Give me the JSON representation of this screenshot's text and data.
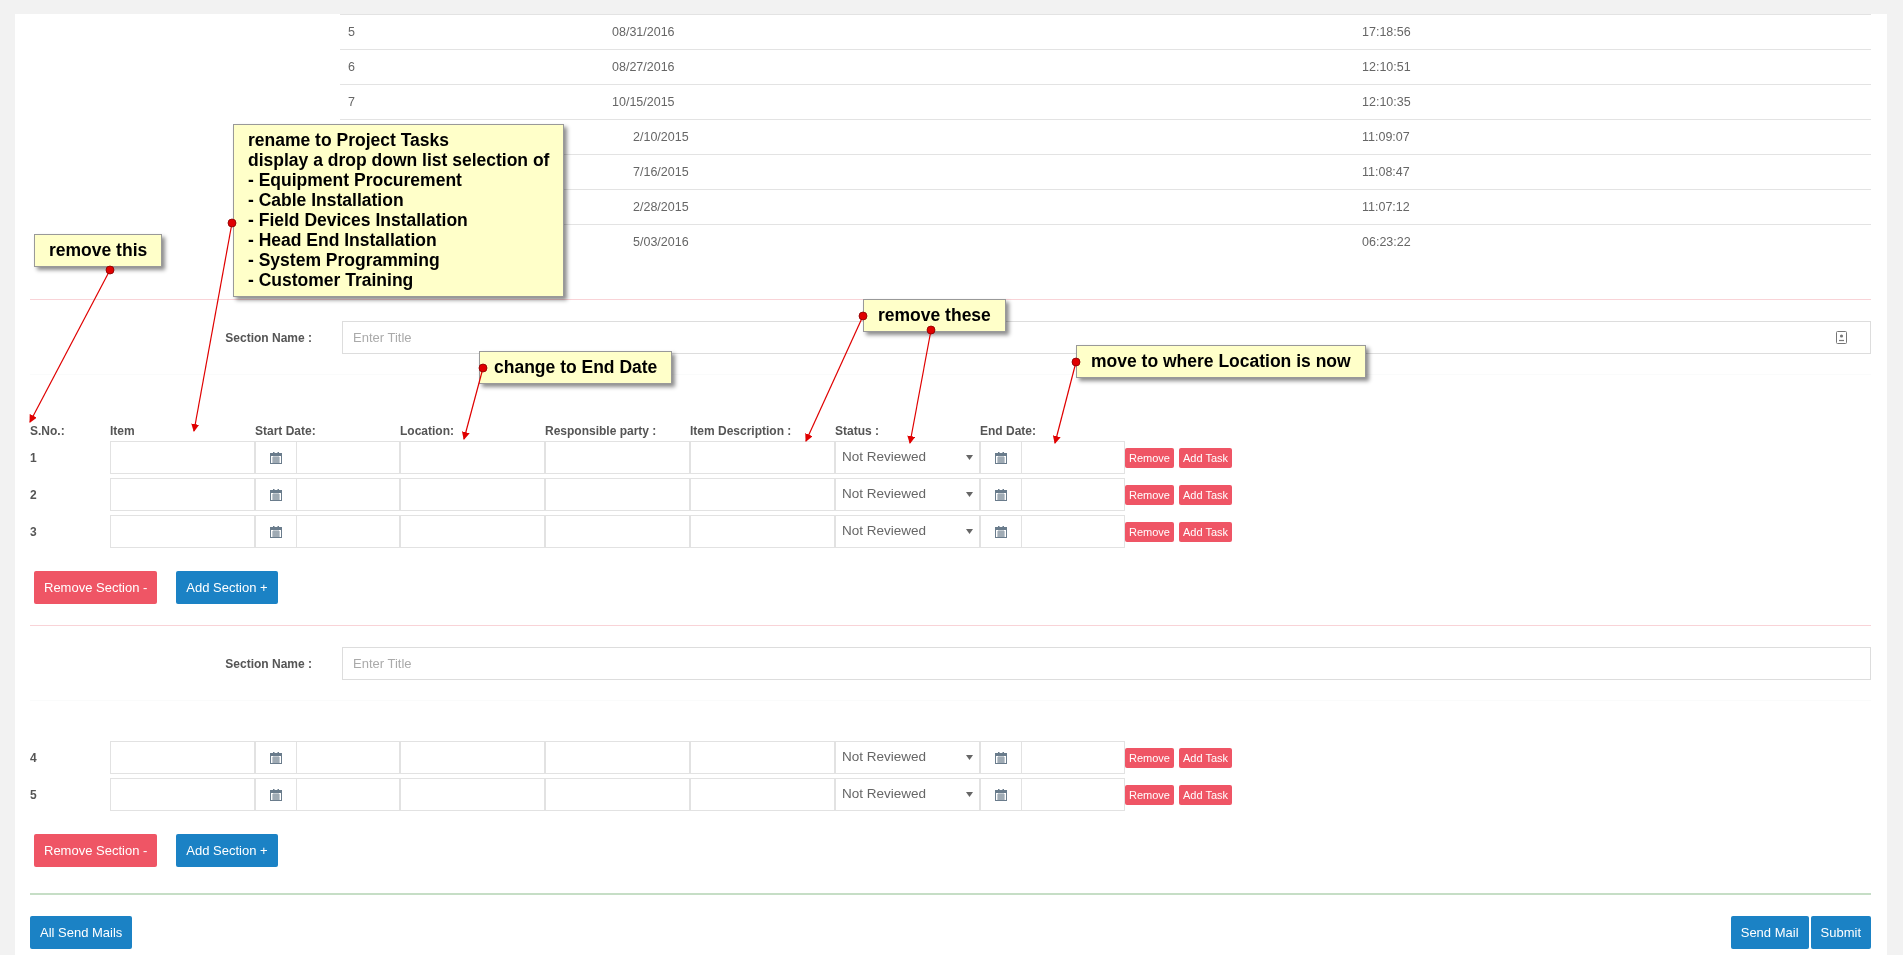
{
  "history_table": {
    "rows": [
      {
        "number": "5",
        "date": "08/31/2016",
        "time": "17:18:56"
      },
      {
        "number": "6",
        "date": "08/27/2016",
        "time": "12:10:51"
      },
      {
        "number": "7",
        "date": "10/15/2015",
        "time": "12:10:35"
      },
      {
        "date": "2/10/2015",
        "time": "11:09:07"
      },
      {
        "date": "7/16/2015",
        "time": "11:08:47"
      },
      {
        "date": "2/28/2015",
        "time": "11:07:12"
      },
      {
        "date": "5/03/2016",
        "time": "06:23:22"
      }
    ]
  },
  "sections": [
    {
      "label": "Section Name :",
      "placeholder": "Enter Title",
      "card_icon": true,
      "columns": [
        "S.No.:",
        "Item",
        "Start Date:",
        "Location:",
        "Responsible party :",
        "Item Description :",
        "Status :",
        "End Date:"
      ],
      "rows": [
        {
          "sno": "1",
          "status": "Not Reviewed",
          "remove": "Remove",
          "add_task": "Add Task"
        },
        {
          "sno": "2",
          "status": "Not Reviewed",
          "remove": "Remove",
          "add_task": "Add Task"
        },
        {
          "sno": "3",
          "status": "Not Reviewed",
          "remove": "Remove",
          "add_task": "Add Task"
        }
      ],
      "remove_section": "Remove Section -",
      "add_section": "Add Section +"
    },
    {
      "label": "Section Name :",
      "placeholder": "Enter Title",
      "card_icon": false,
      "rows": [
        {
          "sno": "4",
          "status": "Not Reviewed",
          "remove": "Remove",
          "add_task": "Add Task"
        },
        {
          "sno": "5",
          "status": "Not Reviewed",
          "remove": "Remove",
          "add_task": "Add Task"
        }
      ],
      "remove_section": "Remove Section -",
      "add_section": "Add Section +"
    }
  ],
  "footer": {
    "left_button": "All Send Mails",
    "right_buttons": [
      "Send Mail",
      "Submit"
    ]
  },
  "callouts": [
    {
      "lines": [
        "remove this"
      ]
    },
    {
      "lines": [
        "rename to Project Tasks",
        "display a drop down list selection of",
        "- Equipment Procurement",
        "- Cable Installation",
        "- Field Devices Installation",
        "- Head End Installation",
        "- System Programming",
        "- Customer Training"
      ]
    },
    {
      "lines": [
        "change to End Date"
      ]
    },
    {
      "lines": [
        "remove these"
      ]
    },
    {
      "lines": [
        "move to where Location is now"
      ]
    }
  ]
}
